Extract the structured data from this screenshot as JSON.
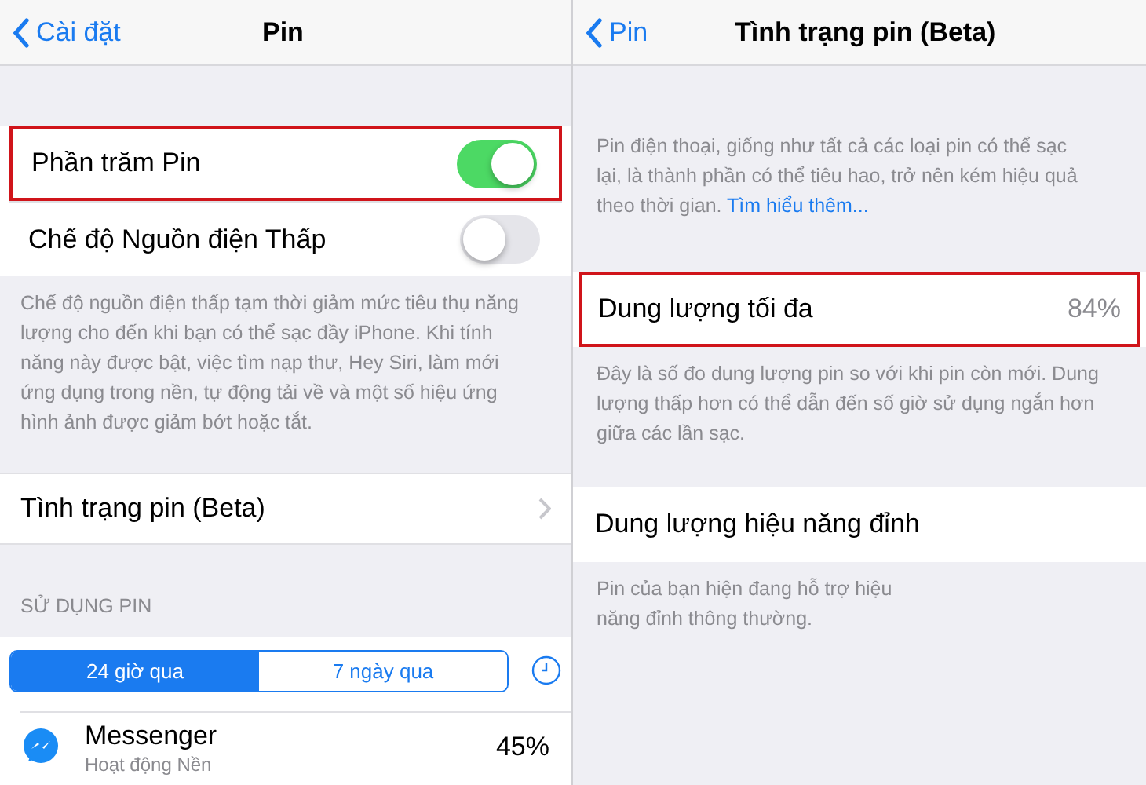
{
  "left": {
    "nav": {
      "back": "Cài đặt",
      "title": "Pin"
    },
    "toggles": [
      {
        "label": "Phần trăm Pin",
        "on": true,
        "highlighted": true
      },
      {
        "label": "Chế độ Nguồn điện Thấp",
        "on": false,
        "highlighted": false
      }
    ],
    "toggles_note": "Chế độ nguồn điện thấp tạm thời giảm mức tiêu thụ năng lượng cho đến khi bạn có thể sạc đầy iPhone. Khi tính năng này được bật, việc tìm nạp thư, Hey Siri, làm mới ứng dụng trong nền, tự động tải về và một số hiệu ứng hình ảnh được giảm bớt hoặc tắt.",
    "health_row": {
      "label": "Tình trạng pin (Beta)"
    },
    "usage_header": "SỬ DỤNG PIN",
    "segments": [
      {
        "label": "24 giờ qua",
        "selected": true
      },
      {
        "label": "7 ngày qua",
        "selected": false
      }
    ],
    "apps": [
      {
        "name": "Messenger",
        "detail": "Hoạt động Nền",
        "percent": "45%"
      }
    ]
  },
  "right": {
    "nav": {
      "back": "Pin",
      "title": "Tình trạng pin (Beta)"
    },
    "intro": "Pin điện thoại, giống như tất cả các loại pin có thể sạc lại, là thành phần có thể tiêu hao, trở nên kém hiệu quả theo thời gian.",
    "intro_link": "Tìm hiểu thêm...",
    "sections": [
      {
        "label": "Dung lượng tối đa",
        "value": "84%",
        "highlighted": true,
        "note": "Đây là số đo dung lượng pin so với khi pin còn mới. Dung lượng thấp hơn có thể dẫn đến số giờ sử dụng ngắn hơn giữa các lần sạc."
      },
      {
        "label": "Dung lượng hiệu năng đỉnh",
        "highlighted": false,
        "note": "Pin của bạn hiện đang hỗ trợ hiệu năng đỉnh thông thường."
      }
    ]
  }
}
